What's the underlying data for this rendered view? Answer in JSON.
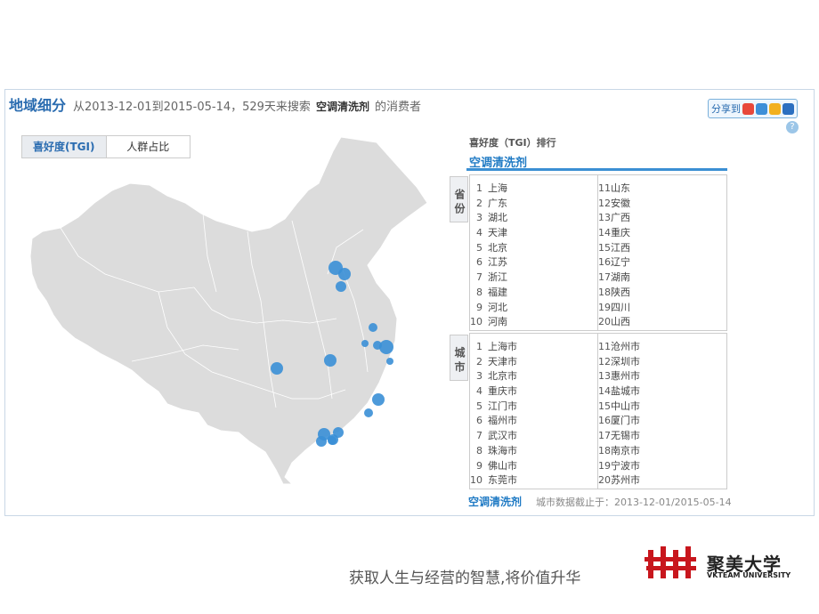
{
  "header": {
    "title": "地域细分",
    "desc_prefix": "从2013-12-01到2015-05-14，529天来搜索",
    "keyword": "空调清洗剂",
    "desc_suffix": "的消费者"
  },
  "share": {
    "label": "分享到"
  },
  "tabs": [
    {
      "label": "喜好度(TGI)",
      "active": true
    },
    {
      "label": "人群占比",
      "active": false
    }
  ],
  "ranking": {
    "title": "喜好度（TGI）排行",
    "keyword": "空调清洗剂",
    "province_label": "省份",
    "city_label": "城市",
    "provinces": [
      {
        "rank": "1",
        "name": "上海"
      },
      {
        "rank": "2",
        "name": "广东"
      },
      {
        "rank": "3",
        "name": "湖北"
      },
      {
        "rank": "4",
        "name": "天津"
      },
      {
        "rank": "5",
        "name": "北京"
      },
      {
        "rank": "6",
        "name": "江苏"
      },
      {
        "rank": "7",
        "name": "浙江"
      },
      {
        "rank": "8",
        "name": "福建"
      },
      {
        "rank": "9",
        "name": "河北"
      },
      {
        "rank": "10",
        "name": "河南"
      },
      {
        "rank": "11",
        "name": "山东"
      },
      {
        "rank": "12",
        "name": "安徽"
      },
      {
        "rank": "13",
        "name": "广西"
      },
      {
        "rank": "14",
        "name": "重庆"
      },
      {
        "rank": "15",
        "name": "江西"
      },
      {
        "rank": "16",
        "name": "辽宁"
      },
      {
        "rank": "17",
        "name": "湖南"
      },
      {
        "rank": "18",
        "name": "陕西"
      },
      {
        "rank": "19",
        "name": "四川"
      },
      {
        "rank": "20",
        "name": "山西"
      }
    ],
    "cities": [
      {
        "rank": "1",
        "name": "上海市"
      },
      {
        "rank": "2",
        "name": "天津市"
      },
      {
        "rank": "3",
        "name": "北京市"
      },
      {
        "rank": "4",
        "name": "重庆市"
      },
      {
        "rank": "5",
        "name": "江门市"
      },
      {
        "rank": "6",
        "name": "福州市"
      },
      {
        "rank": "7",
        "name": "武汉市"
      },
      {
        "rank": "8",
        "name": "珠海市"
      },
      {
        "rank": "9",
        "name": "佛山市"
      },
      {
        "rank": "10",
        "name": "东莞市"
      },
      {
        "rank": "11",
        "name": "沧州市"
      },
      {
        "rank": "12",
        "name": "深圳市"
      },
      {
        "rank": "13",
        "name": "惠州市"
      },
      {
        "rank": "14",
        "name": "盐城市"
      },
      {
        "rank": "15",
        "name": "中山市"
      },
      {
        "rank": "16",
        "name": "厦门市"
      },
      {
        "rank": "17",
        "name": "无锡市"
      },
      {
        "rank": "18",
        "name": "南京市"
      },
      {
        "rank": "19",
        "name": "宁波市"
      },
      {
        "rank": "20",
        "name": "苏州市"
      }
    ]
  },
  "footer": {
    "keyword": "空调清洗剂",
    "note": "城市数据截止于：2013-12-01/2015-05-14"
  },
  "slogan": "获取人生与经营的智慧,将价值升华",
  "logo": {
    "cn": "聚美大学",
    "en": "VKTEAM UNIVERSITY"
  },
  "colors": {
    "accent": "#2a6cb0",
    "bubble": "#3a8fd6",
    "map_fill": "#dcdcdc",
    "logo_red": "#c8161d"
  }
}
